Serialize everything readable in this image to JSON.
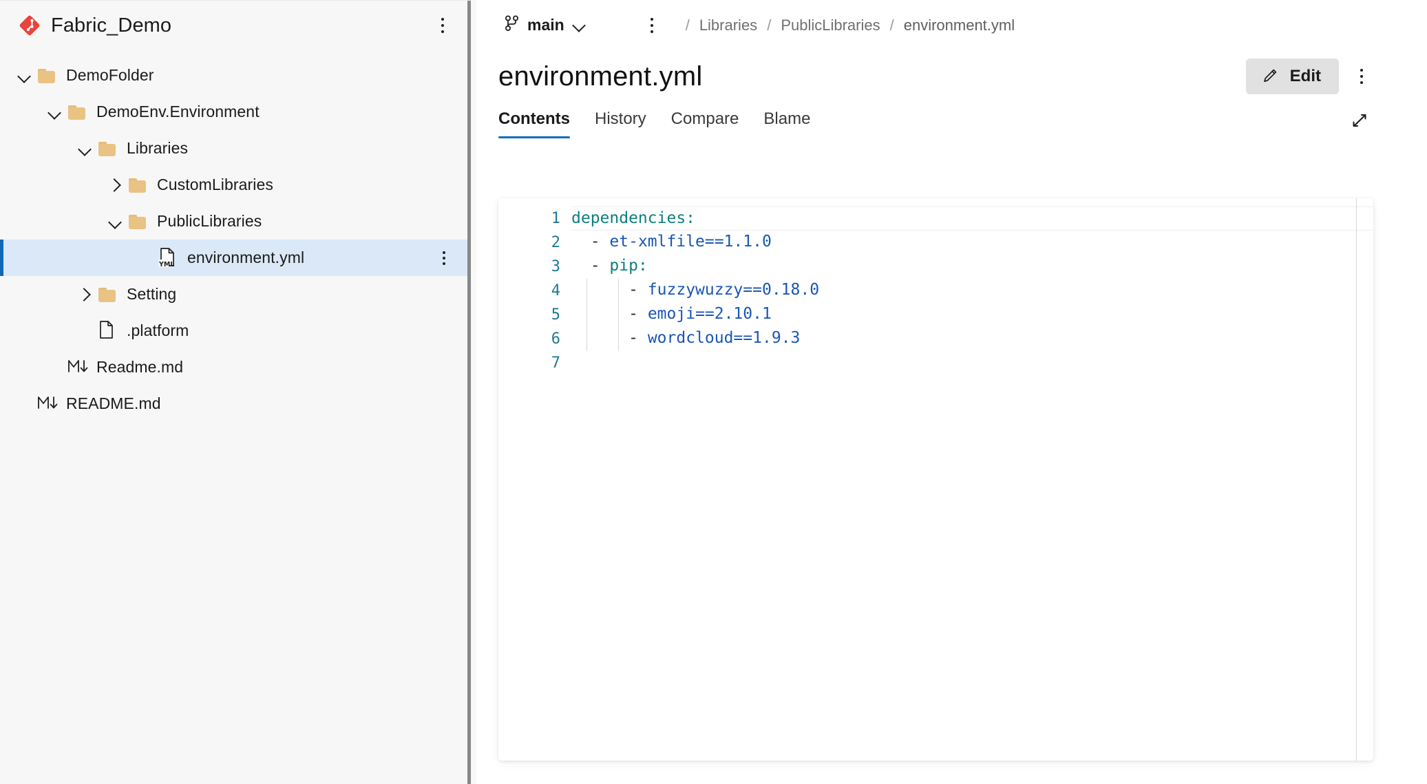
{
  "sidebar": {
    "repo": {
      "name": "Fabric_Demo",
      "logo_icon": "fabric-diamond-logo",
      "logo_color": "#e8453c",
      "menu_icon": "kebab-menu-icon"
    },
    "tree": [
      {
        "label": "DemoFolder",
        "icon": "folder-icon",
        "chevron": "down",
        "depth": 0,
        "selected": false
      },
      {
        "label": "DemoEnv.Environment",
        "icon": "folder-icon",
        "chevron": "down",
        "depth": 1,
        "selected": false
      },
      {
        "label": "Libraries",
        "icon": "folder-icon",
        "chevron": "down",
        "depth": 2,
        "selected": false
      },
      {
        "label": "CustomLibraries",
        "icon": "folder-icon",
        "chevron": "right",
        "depth": 3,
        "selected": false
      },
      {
        "label": "PublicLibraries",
        "icon": "folder-icon",
        "chevron": "down",
        "depth": 3,
        "selected": false
      },
      {
        "label": "environment.yml",
        "icon": "yml-file-icon",
        "chevron": "none",
        "depth": 4,
        "selected": true,
        "menu_icon": "kebab-menu-icon"
      },
      {
        "label": "Setting",
        "icon": "folder-icon",
        "chevron": "right",
        "depth": 2,
        "selected": false
      },
      {
        "label": ".platform",
        "icon": "file-icon",
        "chevron": "none",
        "depth": 2,
        "selected": false
      },
      {
        "label": "Readme.md",
        "icon": "markdown-icon",
        "chevron": "none",
        "depth": 1,
        "selected": false
      },
      {
        "label": "README.md",
        "icon": "markdown-icon",
        "chevron": "none",
        "depth": 0,
        "selected": false
      }
    ],
    "selection_accent_color": "#1267b4",
    "selection_bg_color": "#dbe8f7"
  },
  "toolbar": {
    "branch_icon": "git-branch-icon",
    "branch_name": "main",
    "branch_chevron_icon": "chevron-down-icon",
    "menu_icon": "kebab-menu-icon",
    "breadcrumbs": [
      "Libraries",
      "PublicLibraries",
      "environment.yml"
    ],
    "breadcrumb_separator": "/"
  },
  "header": {
    "file_title": "environment.yml",
    "edit_label": "Edit",
    "edit_icon": "pencil-icon",
    "more_icon": "kebab-menu-icon"
  },
  "tabs": {
    "items": [
      {
        "label": "Contents",
        "active": true
      },
      {
        "label": "History",
        "active": false
      },
      {
        "label": "Compare",
        "active": false
      },
      {
        "label": "Blame",
        "active": false
      }
    ],
    "active_underline_color": "#0f6cbd",
    "expand_icon": "expand-diagonal-icon"
  },
  "editor": {
    "language": "yaml",
    "colors": {
      "key": "#0f7e7e",
      "value": "#1a56b5",
      "line_number": "#237893",
      "punctuation": "#2b2b2b"
    },
    "lines": [
      {
        "n": "1",
        "current": true,
        "indent_guides": 0,
        "tokens": [
          {
            "t": "dependencies",
            "c": "key"
          },
          {
            "t": ":",
            "c": "key"
          }
        ]
      },
      {
        "n": "2",
        "current": false,
        "indent_guides": 0,
        "tokens": [
          {
            "t": "  ",
            "c": "plain"
          },
          {
            "t": "-",
            "c": "dash"
          },
          {
            "t": " ",
            "c": "plain"
          },
          {
            "t": "et-xmlfile==1.1.0",
            "c": "value"
          }
        ]
      },
      {
        "n": "3",
        "current": false,
        "indent_guides": 0,
        "tokens": [
          {
            "t": "  ",
            "c": "plain"
          },
          {
            "t": "-",
            "c": "dash"
          },
          {
            "t": " ",
            "c": "plain"
          },
          {
            "t": "pip",
            "c": "key"
          },
          {
            "t": ":",
            "c": "key"
          }
        ]
      },
      {
        "n": "4",
        "current": false,
        "indent_guides": 2,
        "tokens": [
          {
            "t": "      ",
            "c": "plain"
          },
          {
            "t": "-",
            "c": "dash"
          },
          {
            "t": " ",
            "c": "plain"
          },
          {
            "t": "fuzzywuzzy==0.18.0",
            "c": "value"
          }
        ]
      },
      {
        "n": "5",
        "current": false,
        "indent_guides": 2,
        "tokens": [
          {
            "t": "      ",
            "c": "plain"
          },
          {
            "t": "-",
            "c": "dash"
          },
          {
            "t": " ",
            "c": "plain"
          },
          {
            "t": "emoji==2.10.1",
            "c": "value"
          }
        ]
      },
      {
        "n": "6",
        "current": false,
        "indent_guides": 2,
        "tokens": [
          {
            "t": "      ",
            "c": "plain"
          },
          {
            "t": "-",
            "c": "dash"
          },
          {
            "t": " ",
            "c": "plain"
          },
          {
            "t": "wordcloud==1.9.3",
            "c": "value"
          }
        ]
      },
      {
        "n": "7",
        "current": false,
        "indent_guides": 0,
        "tokens": []
      }
    ]
  }
}
